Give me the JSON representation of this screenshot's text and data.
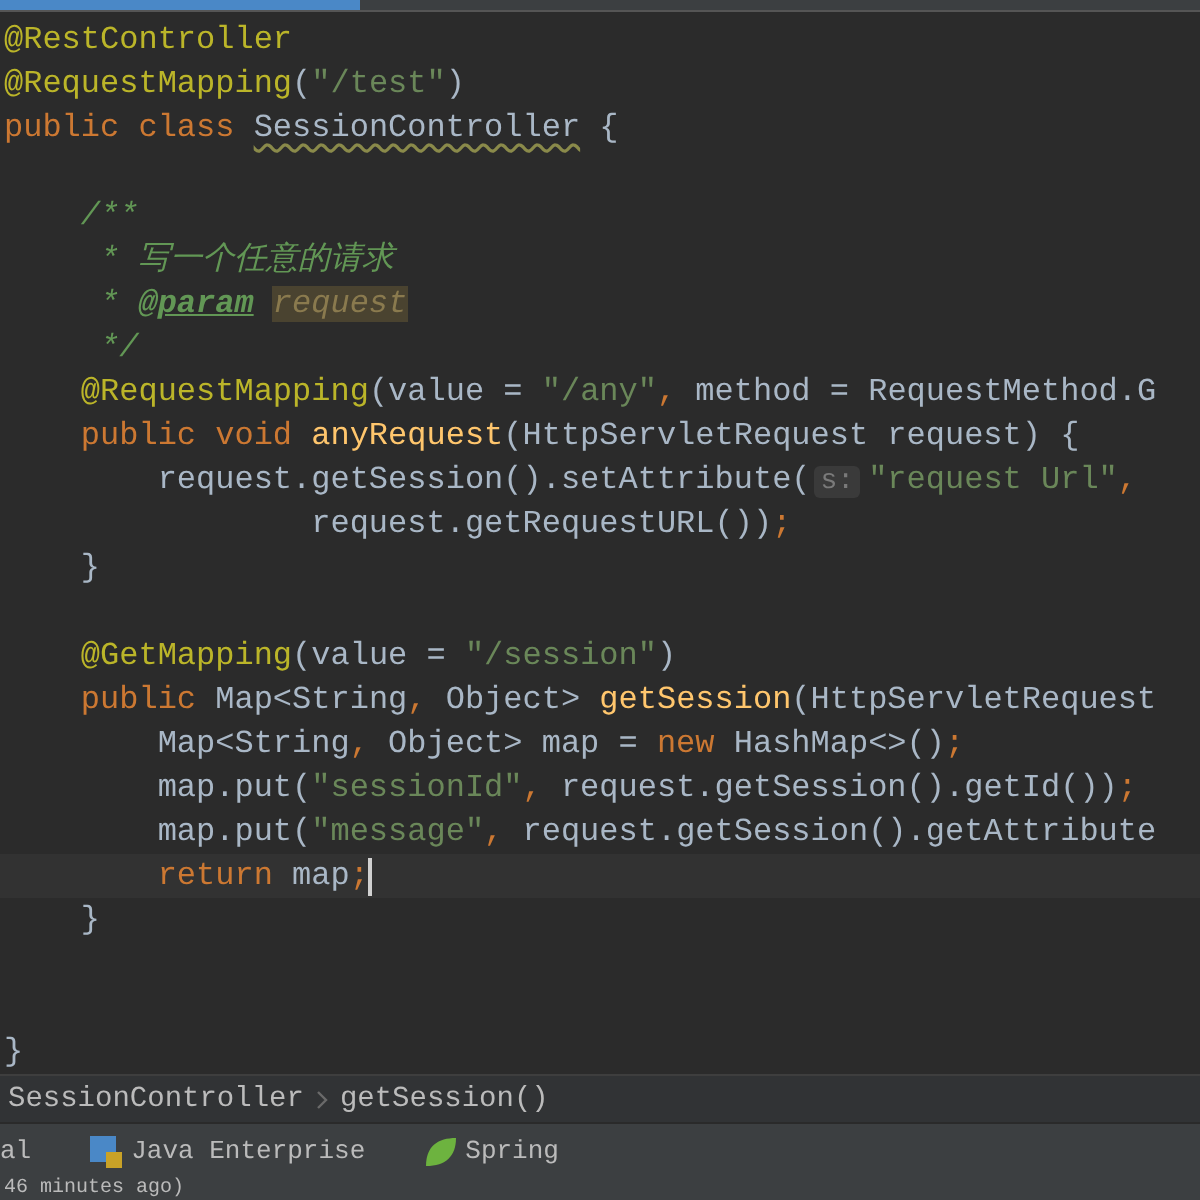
{
  "editor_tab": {
    "selected": true
  },
  "lines": [
    {
      "current": false,
      "tokens": [
        {
          "kind": "annotation",
          "text": "@RestController"
        }
      ]
    },
    {
      "current": false,
      "tokens": [
        {
          "kind": "annotation",
          "text": "@RequestMapping"
        },
        {
          "kind": "plain",
          "text": "("
        },
        {
          "kind": "string",
          "text": "\"/test\""
        },
        {
          "kind": "plain",
          "text": ")"
        }
      ]
    },
    {
      "current": false,
      "tokens": [
        {
          "kind": "keyword",
          "text": "public class "
        },
        {
          "kind": "warning",
          "text": "SessionController"
        },
        {
          "kind": "plain",
          "text": " {"
        }
      ]
    },
    {
      "current": false
    },
    {
      "current": false,
      "tokens": [
        {
          "kind": "doc",
          "text": "    /**"
        }
      ]
    },
    {
      "current": false,
      "tokens": [
        {
          "kind": "doc",
          "text": "     * 写一个任意的请求"
        }
      ]
    },
    {
      "current": false,
      "tokens": [
        {
          "kind": "doc",
          "text": "     * "
        },
        {
          "kind": "doc-tag",
          "text": "@param"
        },
        {
          "kind": "doc-param",
          "text": "request"
        }
      ]
    },
    {
      "current": false,
      "tokens": [
        {
          "kind": "doc",
          "text": "     */"
        }
      ]
    },
    {
      "current": false,
      "tokens": [
        {
          "kind": "annotation",
          "text": "    @RequestMapping"
        },
        {
          "kind": "plain",
          "text": "(value = "
        },
        {
          "kind": "string",
          "text": "\"/any\""
        },
        {
          "kind": "keyword",
          "text": ", "
        },
        {
          "kind": "plain",
          "text": "method = RequestMethod.G"
        }
      ]
    },
    {
      "current": false,
      "tokens": [
        {
          "kind": "keyword",
          "text": "    public void "
        },
        {
          "kind": "declaration",
          "text": "anyRequest"
        },
        {
          "kind": "plain",
          "text": "(HttpServletRequest request) {"
        }
      ]
    },
    {
      "current": false,
      "tokens": [
        {
          "kind": "plain",
          "text": "        request.getSession().setAttribute("
        },
        {
          "kind": "hint",
          "text": "s:"
        },
        {
          "kind": "string",
          "text": "\"request Url\""
        },
        {
          "kind": "keyword",
          "text": ","
        }
      ]
    },
    {
      "current": false,
      "tokens": [
        {
          "kind": "plain",
          "text": "                request.getRequestURL())"
        },
        {
          "kind": "keyword",
          "text": ";"
        }
      ]
    },
    {
      "current": false,
      "tokens": [
        {
          "kind": "plain",
          "text": "    }"
        }
      ]
    },
    {
      "current": false
    },
    {
      "current": false,
      "tokens": [
        {
          "kind": "annotation",
          "text": "    @GetMapping"
        },
        {
          "kind": "plain",
          "text": "(value = "
        },
        {
          "kind": "string",
          "text": "\"/session\""
        },
        {
          "kind": "plain",
          "text": ")"
        }
      ]
    },
    {
      "current": false,
      "tokens": [
        {
          "kind": "keyword",
          "text": "    public "
        },
        {
          "kind": "plain",
          "text": "Map<String"
        },
        {
          "kind": "keyword",
          "text": ", "
        },
        {
          "kind": "plain",
          "text": "Object> "
        },
        {
          "kind": "declaration",
          "text": "getSession"
        },
        {
          "kind": "plain",
          "text": "(HttpServletRequest"
        }
      ]
    },
    {
      "current": false,
      "tokens": [
        {
          "kind": "plain",
          "text": "        Map<String"
        },
        {
          "kind": "keyword",
          "text": ", "
        },
        {
          "kind": "plain",
          "text": "Object> map = "
        },
        {
          "kind": "keyword",
          "text": "new "
        },
        {
          "kind": "plain",
          "text": "HashMap<>()"
        },
        {
          "kind": "keyword",
          "text": ";"
        }
      ]
    },
    {
      "current": false,
      "tokens": [
        {
          "kind": "plain",
          "text": "        map.put("
        },
        {
          "kind": "string",
          "text": "\"sessionId\""
        },
        {
          "kind": "keyword",
          "text": ", "
        },
        {
          "kind": "plain",
          "text": "request.getSession().getId())"
        },
        {
          "kind": "keyword",
          "text": ";"
        }
      ]
    },
    {
      "current": false,
      "tokens": [
        {
          "kind": "plain",
          "text": "        map.put("
        },
        {
          "kind": "string",
          "text": "\"message\""
        },
        {
          "kind": "keyword",
          "text": ", "
        },
        {
          "kind": "plain",
          "text": "request.getSession().getAttribute"
        }
      ]
    },
    {
      "current": true,
      "tokens": [
        {
          "kind": "keyword",
          "text": "        return "
        },
        {
          "kind": "plain",
          "text": "map"
        },
        {
          "kind": "keyword",
          "text": ";"
        }
      ]
    },
    {
      "current": false,
      "tokens": [
        {
          "kind": "plain",
          "text": "    }"
        }
      ]
    },
    {
      "current": false
    },
    {
      "current": false
    },
    {
      "current": false,
      "tokens": [
        {
          "kind": "plain",
          "text": "}"
        }
      ]
    }
  ],
  "breadcrumbs": [
    "SessionController",
    "getSession()"
  ],
  "tool_windows": [
    {
      "kind": "none",
      "label": "al"
    },
    {
      "kind": "java-ee",
      "label": "Java Enterprise"
    },
    {
      "kind": "spring",
      "label": "Spring"
    }
  ],
  "status_bar": {
    "text": "46 minutes ago)"
  }
}
